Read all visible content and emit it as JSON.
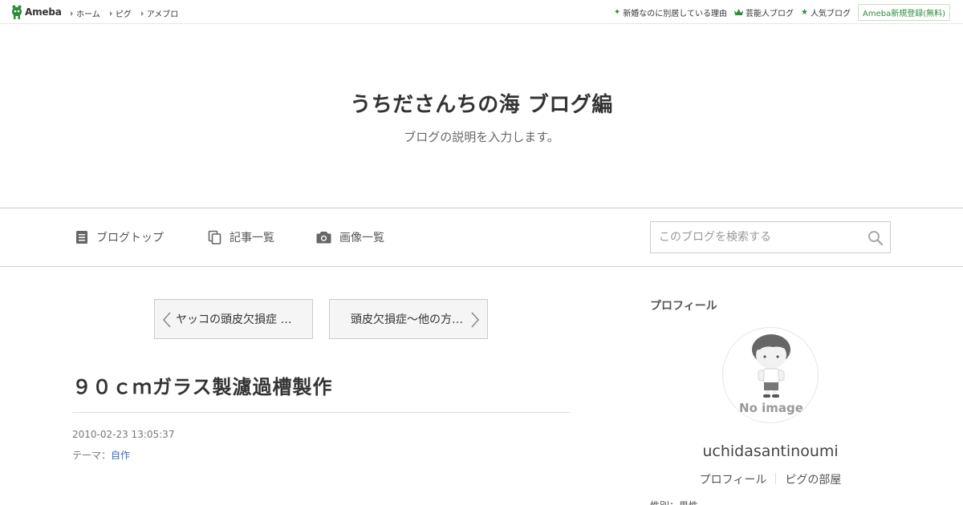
{
  "header": {
    "logo_text": "Ameba",
    "nav": [
      "ホーム",
      "ピグ",
      "アメブロ"
    ],
    "right_links": [
      {
        "label": "新婚なのに別居している理由",
        "icon": "sparkle-icon"
      },
      {
        "label": "芸能人ブログ",
        "icon": "crown-icon"
      },
      {
        "label": "人気ブログ",
        "icon": "star-icon"
      }
    ],
    "signup_label": "Ameba新規登録(無料)"
  },
  "blog": {
    "title": "うちださんちの海 ブログ編",
    "description": "ブログの説明を入力します。"
  },
  "navbar": {
    "items": [
      {
        "label": "ブログトップ",
        "icon": "document-icon"
      },
      {
        "label": "記事一覧",
        "icon": "copy-icon"
      },
      {
        "label": "画像一覧",
        "icon": "camera-icon"
      }
    ],
    "search_placeholder": "このブログを検索する"
  },
  "pager": {
    "prev_label": "ヤッコの頭皮欠損症 …",
    "next_label": "頭皮欠損症～他の方…"
  },
  "article": {
    "title": "９０ｃｍガラス製濾過槽製作",
    "date": "2010-02-23 13:05:37",
    "theme_label": "テーマ：",
    "theme_value": "自作"
  },
  "sidebar": {
    "heading": "プロフィール",
    "avatar_text": "No image",
    "profile_name": "uchidasantinoumi",
    "links": [
      "プロフィール",
      "ピグの部屋"
    ],
    "partial_text": "性別：男性"
  },
  "colors": {
    "accent_green": "#2d8c3c",
    "link_blue": "#3b6fb6"
  }
}
